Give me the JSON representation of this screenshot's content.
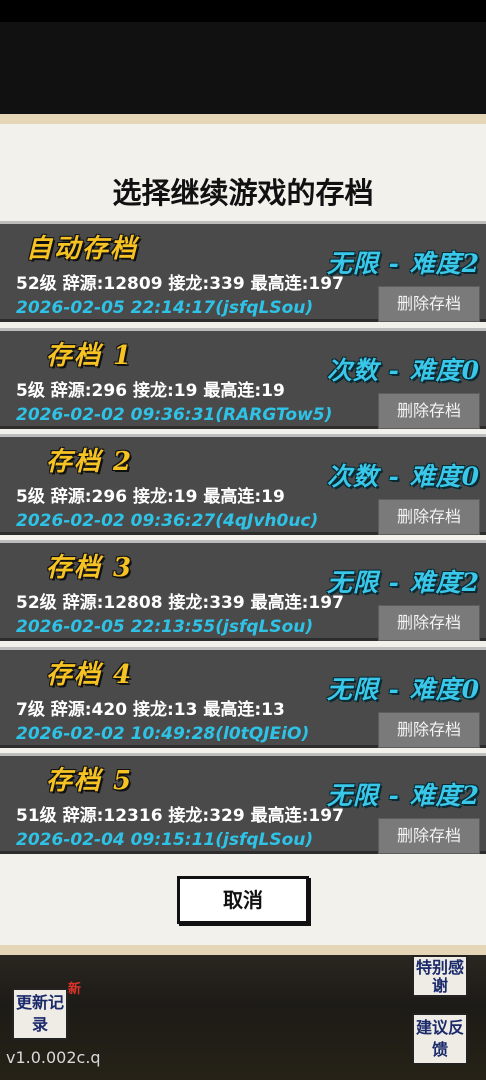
{
  "dialog": {
    "title": "选择继续游戏的存档",
    "cancel_label": "取消"
  },
  "slots": [
    {
      "name": "自动存档",
      "mode": "无限 - 难度2",
      "stats": "52级 辞源:12809 接龙:339 最高连:197",
      "time": "2026-02-05 22:14:17(jsfqLSou)",
      "delete_label": "删除存档"
    },
    {
      "name": "存档 1",
      "mode": "次数 - 难度0",
      "stats": "5级 辞源:296 接龙:19 最高连:19",
      "time": "2026-02-02 09:36:31(RARGTow5)",
      "delete_label": "删除存档"
    },
    {
      "name": "存档 2",
      "mode": "次数 - 难度0",
      "stats": "5级 辞源:296 接龙:19 最高连:19",
      "time": "2026-02-02 09:36:27(4qJvh0uc)",
      "delete_label": "删除存档"
    },
    {
      "name": "存档 3",
      "mode": "无限 - 难度2",
      "stats": "52级 辞源:12808 接龙:339 最高连:197",
      "time": "2026-02-05 22:13:55(jsfqLSou)",
      "delete_label": "删除存档"
    },
    {
      "name": "存档 4",
      "mode": "无限 - 难度0",
      "stats": "7级 辞源:420 接龙:13 最高连:13",
      "time": "2026-02-02 10:49:28(l0tQJEiO)",
      "delete_label": "删除存档"
    },
    {
      "name": "存档 5",
      "mode": "无限 - 难度2",
      "stats": "51级 辞源:12316 接龙:329 最高连:197",
      "time": "2026-02-04 09:15:11(jsfqLSou)",
      "delete_label": "删除存档"
    }
  ],
  "background": {
    "update_log_label": "更新记录",
    "new_badge": "新",
    "thanks_label": "特别感谢",
    "feedback_label": "建议反馈",
    "version": "v1.0.002c.q"
  },
  "colors": {
    "slot_name": "#f7c322",
    "slot_mode": "#39c8ea",
    "timestamp": "#2ec3e6",
    "dialog_bg": "#f3f1ec"
  }
}
